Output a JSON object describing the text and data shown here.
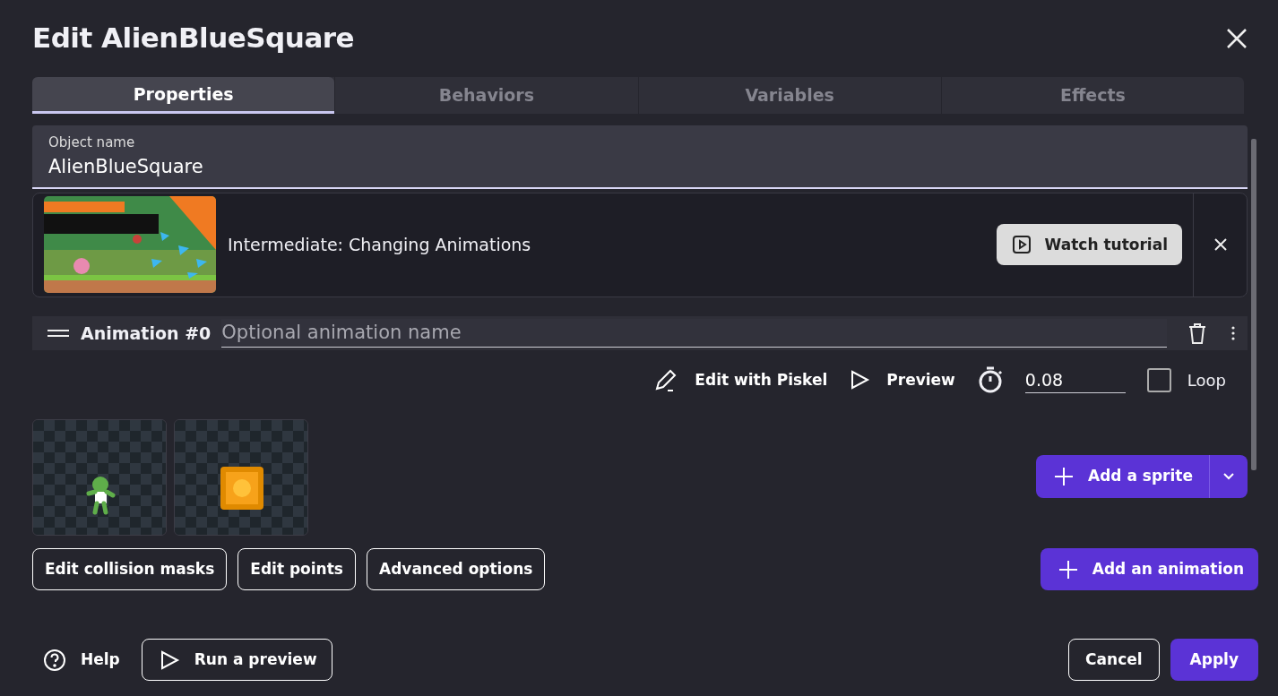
{
  "dialog": {
    "title": "Edit AlienBlueSquare"
  },
  "tabs": [
    {
      "label": "Properties",
      "selected": true
    },
    {
      "label": "Behaviors",
      "selected": false
    },
    {
      "label": "Variables",
      "selected": false
    },
    {
      "label": "Effects",
      "selected": false
    }
  ],
  "object_name": {
    "label": "Object name",
    "value": "AlienBlueSquare"
  },
  "tutorial": {
    "title": "Intermediate: Changing Animations",
    "button": "Watch tutorial"
  },
  "animation": {
    "label": "Animation #0",
    "placeholder": "Optional animation name",
    "actions": [
      {
        "kind": "edit",
        "label": "Edit with Piskel"
      },
      {
        "kind": "preview",
        "label": "Preview"
      }
    ],
    "duration": "0.08",
    "loop": {
      "label": "Loop",
      "checked": false
    },
    "sprites": [
      {
        "kind": "character"
      },
      {
        "kind": "gem"
      }
    ],
    "add_sprite": "Add a sprite"
  },
  "object_buttons": [
    "Edit collision masks",
    "Edit points",
    "Advanced options"
  ],
  "add_animation": "Add an animation",
  "footer": {
    "help": "Help",
    "run_preview": "Run a preview",
    "cancel": "Cancel",
    "apply": "Apply"
  }
}
